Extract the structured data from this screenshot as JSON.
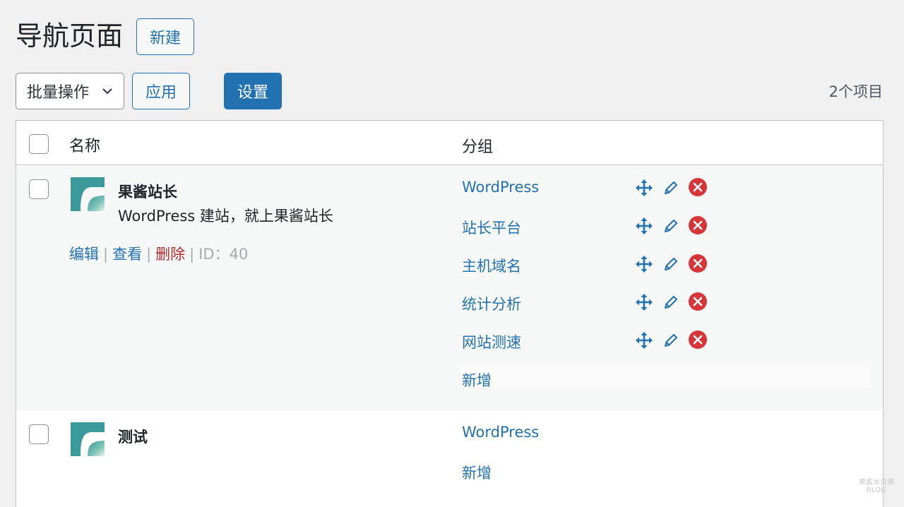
{
  "header": {
    "title": "导航页面",
    "new_button": "新建"
  },
  "toolbar": {
    "bulk_action": "批量操作",
    "apply": "应用",
    "settings": "设置",
    "item_count": "2个项目"
  },
  "table": {
    "columns": [
      "名称",
      "分组"
    ],
    "rows": [
      {
        "name": "果酱站长",
        "description": "WordPress 建站，就上果酱站长",
        "actions": {
          "edit": "编辑",
          "view": "查看",
          "delete": "删除",
          "id": "ID：40"
        },
        "groups": [
          "WordPress",
          "站长平台",
          "主机域名",
          "统计分析",
          "网站测速"
        ],
        "add_label": "新增"
      },
      {
        "name": "测试",
        "description": "",
        "groups": [
          "WordPress"
        ],
        "add_label": "新增"
      }
    ]
  },
  "icons": {
    "move": "move-icon",
    "edit": "pencil-icon",
    "remove": "close-circle-icon"
  },
  "colors": {
    "accent": "#2271b1",
    "delete": "#b32d2e",
    "remove_icon": "#d63638",
    "logo_teal": "#3a9a9a"
  },
  "watermark": {
    "line1": "果酱水资源",
    "line2": "BLOG"
  }
}
